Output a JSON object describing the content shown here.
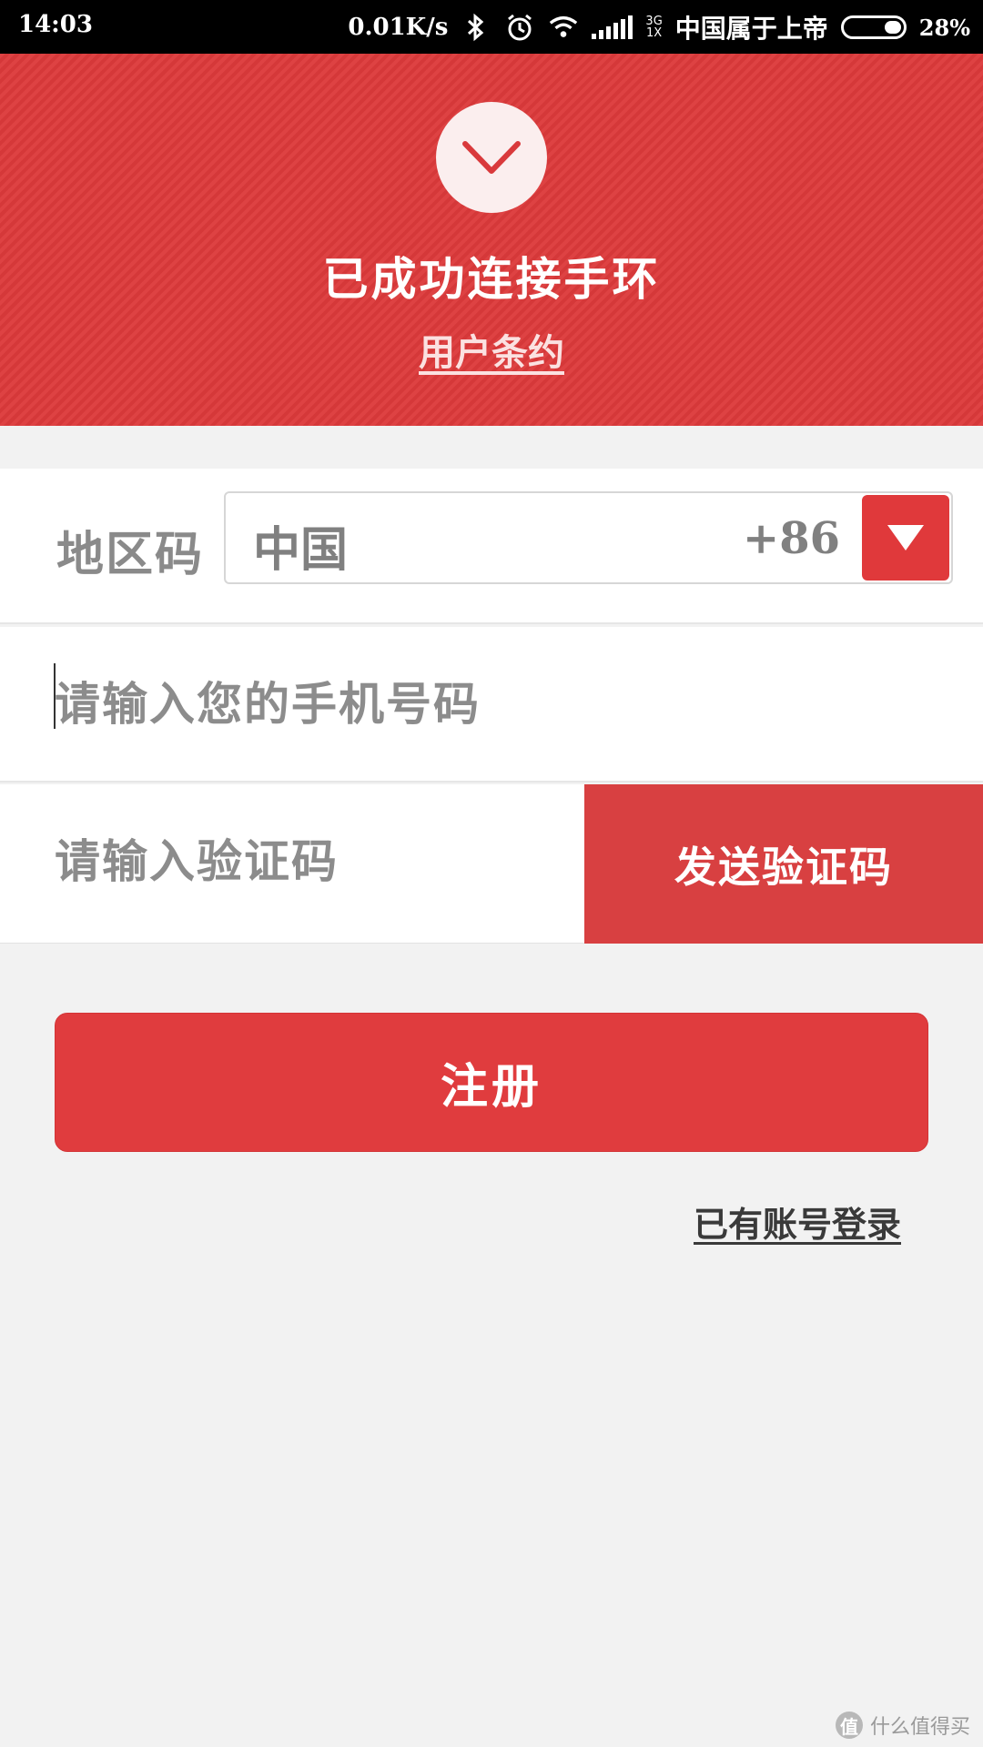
{
  "status_bar": {
    "time": "14:03",
    "net_speed": "0.01K/s",
    "network_type_top": "3G",
    "network_type_bottom": "1X",
    "carrier": "中国属于上帝",
    "battery_percent": "28%",
    "battery_level": 0.28,
    "icons": [
      "bluetooth-icon",
      "alarm-icon",
      "wifi-icon",
      "signal-icon",
      "battery-icon"
    ]
  },
  "header": {
    "title": "已成功连接手环",
    "agreement_link": "用户条约",
    "icon": "check-icon",
    "background_color": "#dc3a3b"
  },
  "form": {
    "region_label": "地区码",
    "region_name": "中国",
    "region_code": "+86",
    "dropdown_icon": "triangle-down-icon",
    "phone_placeholder": "请输入您的手机号码",
    "code_placeholder": "请输入验证码",
    "send_code_label": "发送验证码"
  },
  "actions": {
    "register_label": "注册",
    "login_link": "已有账号登录"
  },
  "watermark": {
    "badge": "值",
    "text": "什么值得买"
  },
  "colors": {
    "accent": "#e03c3e",
    "page_background": "#f2f2f2"
  }
}
